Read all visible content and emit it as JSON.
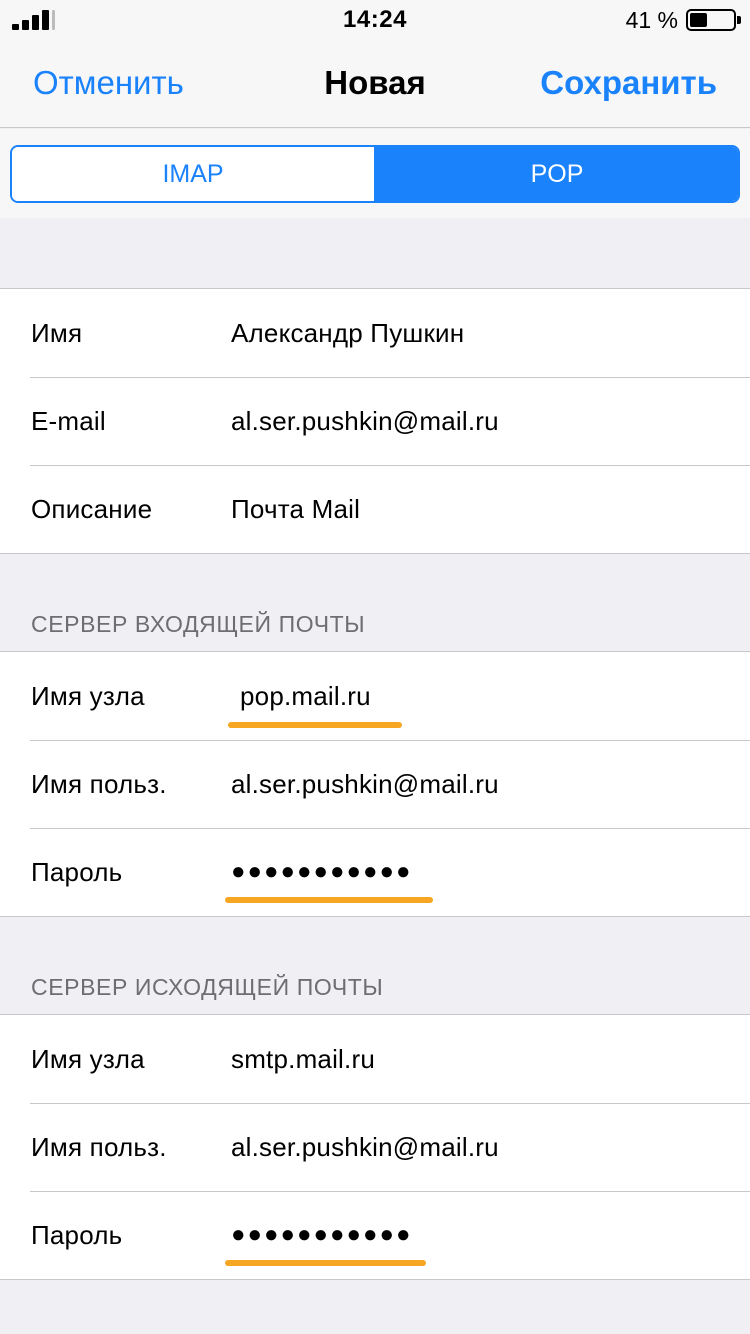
{
  "status_bar": {
    "time": "14:24",
    "battery_percent": "41 %",
    "battery_level": 0.41,
    "signal_bars": 4
  },
  "nav": {
    "cancel_label": "Отменить",
    "title": "Новая",
    "save_label": "Сохранить"
  },
  "account_type": {
    "options": [
      "IMAP",
      "POP"
    ],
    "selected": "POP"
  },
  "account": {
    "name_label": "Имя",
    "name_value": "Александр Пушкин",
    "email_label": "E-mail",
    "email_value": "al.ser.pushkin@mail.ru",
    "description_label": "Описание",
    "description_value": "Почта Mail"
  },
  "incoming": {
    "header": "СЕРВЕР ВХОДЯЩЕЙ ПОЧТЫ",
    "host_label": "Имя узла",
    "host_value": "pop.mail.ru",
    "user_label": "Имя польз.",
    "user_value": "al.ser.pushkin@mail.ru",
    "password_label": "Пароль",
    "password_value": "●●●●●●●●●●●"
  },
  "outgoing": {
    "header": "СЕРВЕР ИСХОДЯЩЕЙ ПОЧТЫ",
    "host_label": "Имя узла",
    "host_value": "smtp.mail.ru",
    "user_label": "Имя польз.",
    "user_value": "al.ser.pushkin@mail.ru",
    "password_label": "Пароль",
    "password_value": "●●●●●●●●●●●"
  },
  "colors": {
    "accent": "#1a82fb",
    "highlight_underline": "#f6a623",
    "background": "#efeff4"
  }
}
